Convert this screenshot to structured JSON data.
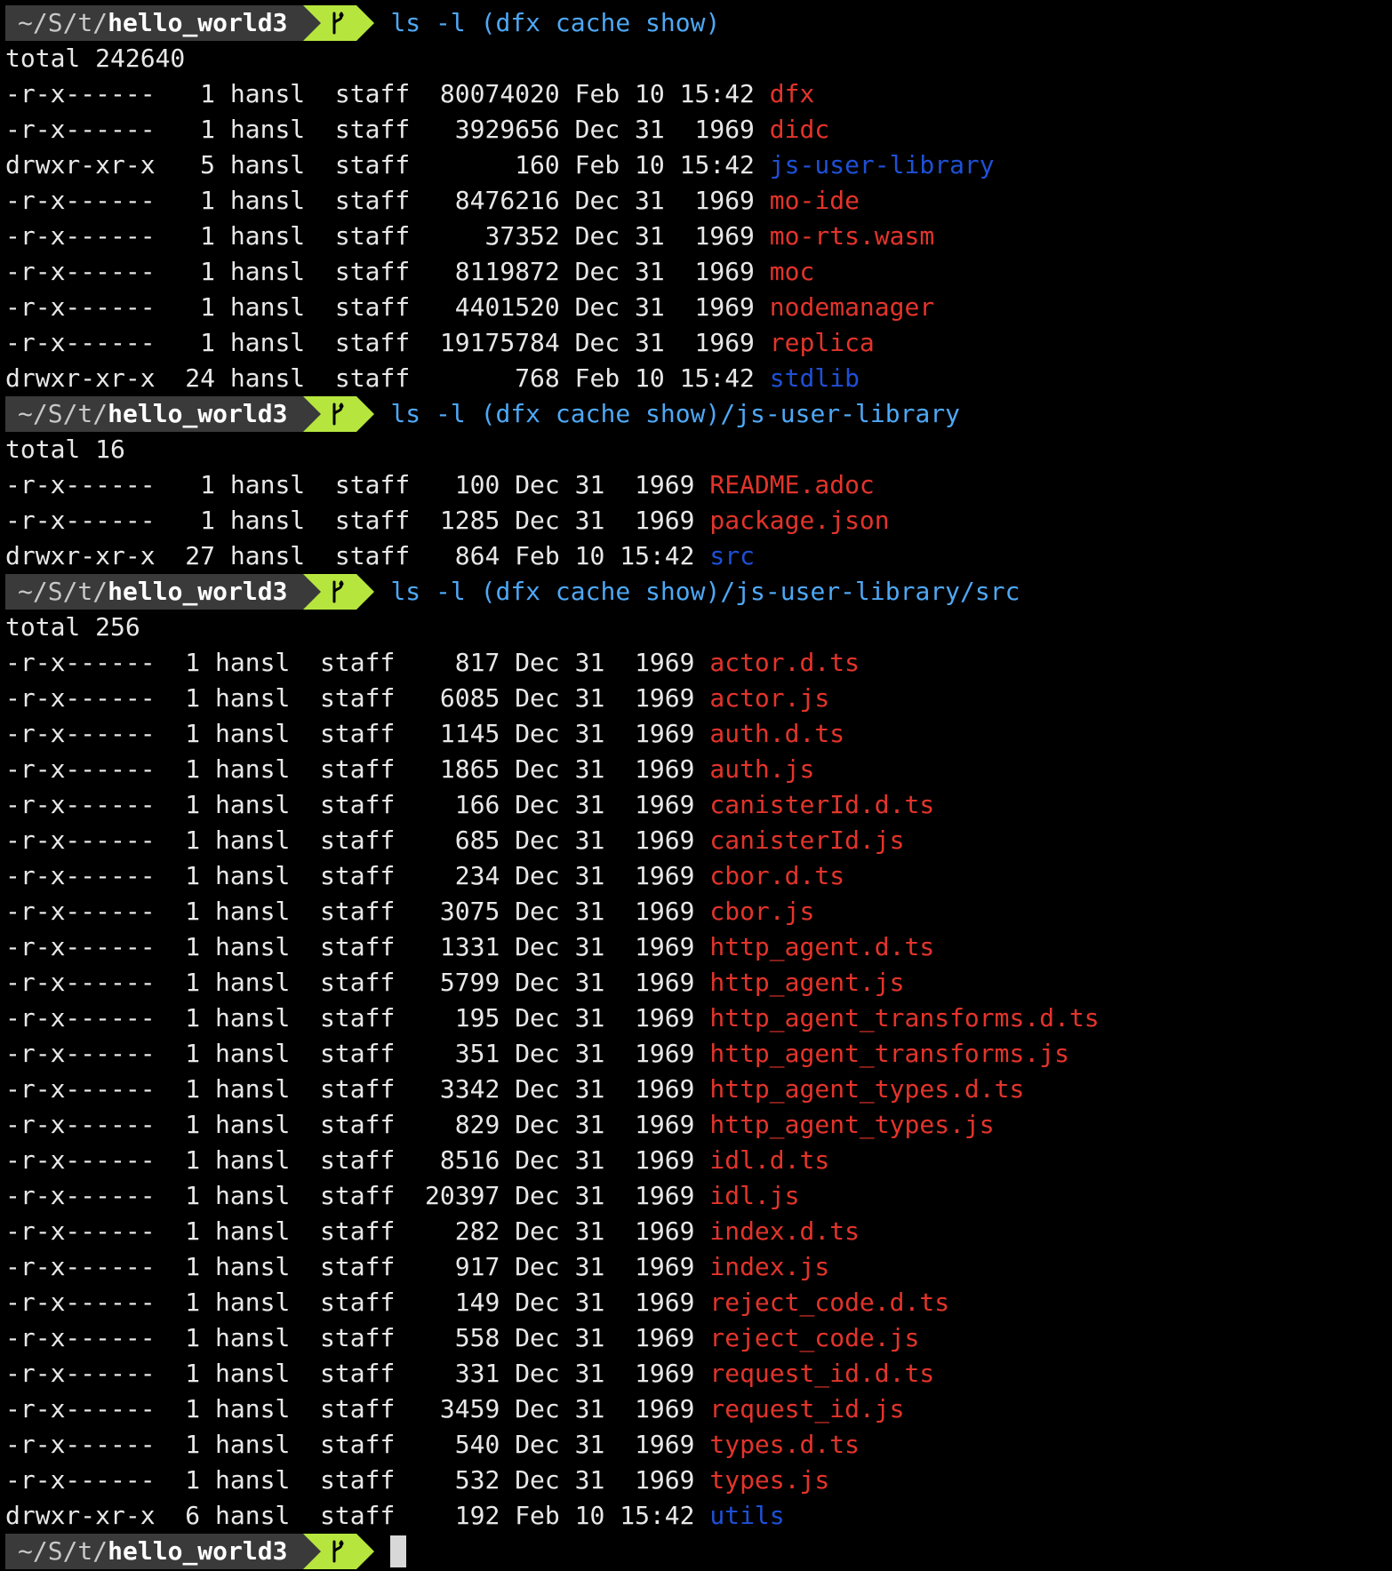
{
  "prompt": {
    "path_prefix": "~/S/t/",
    "dir": "hello_world3",
    "branch_icon": "git-branch-icon"
  },
  "colors": {
    "exec_file": "#e3342b",
    "directory": "#1e50d6",
    "command": "#4ea8f5",
    "prompt_bg": "#3a3a3a",
    "git_bg": "#b6e63e"
  },
  "blocks": [
    {
      "command": "ls -l (dfx cache show)",
      "total": "total 242640",
      "rows": [
        {
          "perm": "-r-x------ ",
          "links": "  1",
          "owner": "hansl",
          "group": "staff",
          "size": "80074020",
          "date": "Feb 10 15:42",
          "name": "dfx",
          "kind": "exec"
        },
        {
          "perm": "-r-x------ ",
          "links": "  1",
          "owner": "hansl",
          "group": "staff",
          "size": " 3929656",
          "date": "Dec 31  1969",
          "name": "didc",
          "kind": "exec"
        },
        {
          "perm": "drwxr-xr-x ",
          "links": "  5",
          "owner": "hansl",
          "group": "staff",
          "size": "     160",
          "date": "Feb 10 15:42",
          "name": "js-user-library",
          "kind": "dir"
        },
        {
          "perm": "-r-x------ ",
          "links": "  1",
          "owner": "hansl",
          "group": "staff",
          "size": " 8476216",
          "date": "Dec 31  1969",
          "name": "mo-ide",
          "kind": "exec"
        },
        {
          "perm": "-r-x------ ",
          "links": "  1",
          "owner": "hansl",
          "group": "staff",
          "size": "   37352",
          "date": "Dec 31  1969",
          "name": "mo-rts.wasm",
          "kind": "exec"
        },
        {
          "perm": "-r-x------ ",
          "links": "  1",
          "owner": "hansl",
          "group": "staff",
          "size": " 8119872",
          "date": "Dec 31  1969",
          "name": "moc",
          "kind": "exec"
        },
        {
          "perm": "-r-x------ ",
          "links": "  1",
          "owner": "hansl",
          "group": "staff",
          "size": " 4401520",
          "date": "Dec 31  1969",
          "name": "nodemanager",
          "kind": "exec"
        },
        {
          "perm": "-r-x------ ",
          "links": "  1",
          "owner": "hansl",
          "group": "staff",
          "size": "19175784",
          "date": "Dec 31  1969",
          "name": "replica",
          "kind": "exec"
        },
        {
          "perm": "drwxr-xr-x ",
          "links": " 24",
          "owner": "hansl",
          "group": "staff",
          "size": "     768",
          "date": "Feb 10 15:42",
          "name": "stdlib",
          "kind": "dir"
        }
      ]
    },
    {
      "command": "ls -l (dfx cache show)/js-user-library",
      "total": "total 16",
      "rows": [
        {
          "perm": "-r-x------ ",
          "links": "  1",
          "owner": "hansl",
          "group": "staff",
          "size": " 100",
          "date": "Dec 31  1969",
          "name": "README.adoc",
          "kind": "exec"
        },
        {
          "perm": "-r-x------ ",
          "links": "  1",
          "owner": "hansl",
          "group": "staff",
          "size": "1285",
          "date": "Dec 31  1969",
          "name": "package.json",
          "kind": "exec"
        },
        {
          "perm": "drwxr-xr-x ",
          "links": " 27",
          "owner": "hansl",
          "group": "staff",
          "size": " 864",
          "date": "Feb 10 15:42",
          "name": "src",
          "kind": "dir"
        }
      ]
    },
    {
      "command": "ls -l (dfx cache show)/js-user-library/src",
      "total": "total 256",
      "rows": [
        {
          "perm": "-r-x------ ",
          "links": " 1",
          "owner": "hansl",
          "group": "staff",
          "size": "  817",
          "date": "Dec 31  1969",
          "name": "actor.d.ts",
          "kind": "exec"
        },
        {
          "perm": "-r-x------ ",
          "links": " 1",
          "owner": "hansl",
          "group": "staff",
          "size": " 6085",
          "date": "Dec 31  1969",
          "name": "actor.js",
          "kind": "exec"
        },
        {
          "perm": "-r-x------ ",
          "links": " 1",
          "owner": "hansl",
          "group": "staff",
          "size": " 1145",
          "date": "Dec 31  1969",
          "name": "auth.d.ts",
          "kind": "exec"
        },
        {
          "perm": "-r-x------ ",
          "links": " 1",
          "owner": "hansl",
          "group": "staff",
          "size": " 1865",
          "date": "Dec 31  1969",
          "name": "auth.js",
          "kind": "exec"
        },
        {
          "perm": "-r-x------ ",
          "links": " 1",
          "owner": "hansl",
          "group": "staff",
          "size": "  166",
          "date": "Dec 31  1969",
          "name": "canisterId.d.ts",
          "kind": "exec"
        },
        {
          "perm": "-r-x------ ",
          "links": " 1",
          "owner": "hansl",
          "group": "staff",
          "size": "  685",
          "date": "Dec 31  1969",
          "name": "canisterId.js",
          "kind": "exec"
        },
        {
          "perm": "-r-x------ ",
          "links": " 1",
          "owner": "hansl",
          "group": "staff",
          "size": "  234",
          "date": "Dec 31  1969",
          "name": "cbor.d.ts",
          "kind": "exec"
        },
        {
          "perm": "-r-x------ ",
          "links": " 1",
          "owner": "hansl",
          "group": "staff",
          "size": " 3075",
          "date": "Dec 31  1969",
          "name": "cbor.js",
          "kind": "exec"
        },
        {
          "perm": "-r-x------ ",
          "links": " 1",
          "owner": "hansl",
          "group": "staff",
          "size": " 1331",
          "date": "Dec 31  1969",
          "name": "http_agent.d.ts",
          "kind": "exec"
        },
        {
          "perm": "-r-x------ ",
          "links": " 1",
          "owner": "hansl",
          "group": "staff",
          "size": " 5799",
          "date": "Dec 31  1969",
          "name": "http_agent.js",
          "kind": "exec"
        },
        {
          "perm": "-r-x------ ",
          "links": " 1",
          "owner": "hansl",
          "group": "staff",
          "size": "  195",
          "date": "Dec 31  1969",
          "name": "http_agent_transforms.d.ts",
          "kind": "exec"
        },
        {
          "perm": "-r-x------ ",
          "links": " 1",
          "owner": "hansl",
          "group": "staff",
          "size": "  351",
          "date": "Dec 31  1969",
          "name": "http_agent_transforms.js",
          "kind": "exec"
        },
        {
          "perm": "-r-x------ ",
          "links": " 1",
          "owner": "hansl",
          "group": "staff",
          "size": " 3342",
          "date": "Dec 31  1969",
          "name": "http_agent_types.d.ts",
          "kind": "exec"
        },
        {
          "perm": "-r-x------ ",
          "links": " 1",
          "owner": "hansl",
          "group": "staff",
          "size": "  829",
          "date": "Dec 31  1969",
          "name": "http_agent_types.js",
          "kind": "exec"
        },
        {
          "perm": "-r-x------ ",
          "links": " 1",
          "owner": "hansl",
          "group": "staff",
          "size": " 8516",
          "date": "Dec 31  1969",
          "name": "idl.d.ts",
          "kind": "exec"
        },
        {
          "perm": "-r-x------ ",
          "links": " 1",
          "owner": "hansl",
          "group": "staff",
          "size": "20397",
          "date": "Dec 31  1969",
          "name": "idl.js",
          "kind": "exec"
        },
        {
          "perm": "-r-x------ ",
          "links": " 1",
          "owner": "hansl",
          "group": "staff",
          "size": "  282",
          "date": "Dec 31  1969",
          "name": "index.d.ts",
          "kind": "exec"
        },
        {
          "perm": "-r-x------ ",
          "links": " 1",
          "owner": "hansl",
          "group": "staff",
          "size": "  917",
          "date": "Dec 31  1969",
          "name": "index.js",
          "kind": "exec"
        },
        {
          "perm": "-r-x------ ",
          "links": " 1",
          "owner": "hansl",
          "group": "staff",
          "size": "  149",
          "date": "Dec 31  1969",
          "name": "reject_code.d.ts",
          "kind": "exec"
        },
        {
          "perm": "-r-x------ ",
          "links": " 1",
          "owner": "hansl",
          "group": "staff",
          "size": "  558",
          "date": "Dec 31  1969",
          "name": "reject_code.js",
          "kind": "exec"
        },
        {
          "perm": "-r-x------ ",
          "links": " 1",
          "owner": "hansl",
          "group": "staff",
          "size": "  331",
          "date": "Dec 31  1969",
          "name": "request_id.d.ts",
          "kind": "exec"
        },
        {
          "perm": "-r-x------ ",
          "links": " 1",
          "owner": "hansl",
          "group": "staff",
          "size": " 3459",
          "date": "Dec 31  1969",
          "name": "request_id.js",
          "kind": "exec"
        },
        {
          "perm": "-r-x------ ",
          "links": " 1",
          "owner": "hansl",
          "group": "staff",
          "size": "  540",
          "date": "Dec 31  1969",
          "name": "types.d.ts",
          "kind": "exec"
        },
        {
          "perm": "-r-x------ ",
          "links": " 1",
          "owner": "hansl",
          "group": "staff",
          "size": "  532",
          "date": "Dec 31  1969",
          "name": "types.js",
          "kind": "exec"
        },
        {
          "perm": "drwxr-xr-x ",
          "links": " 6",
          "owner": "hansl",
          "group": "staff",
          "size": "  192",
          "date": "Feb 10 15:42",
          "name": "utils",
          "kind": "dir"
        }
      ]
    }
  ]
}
